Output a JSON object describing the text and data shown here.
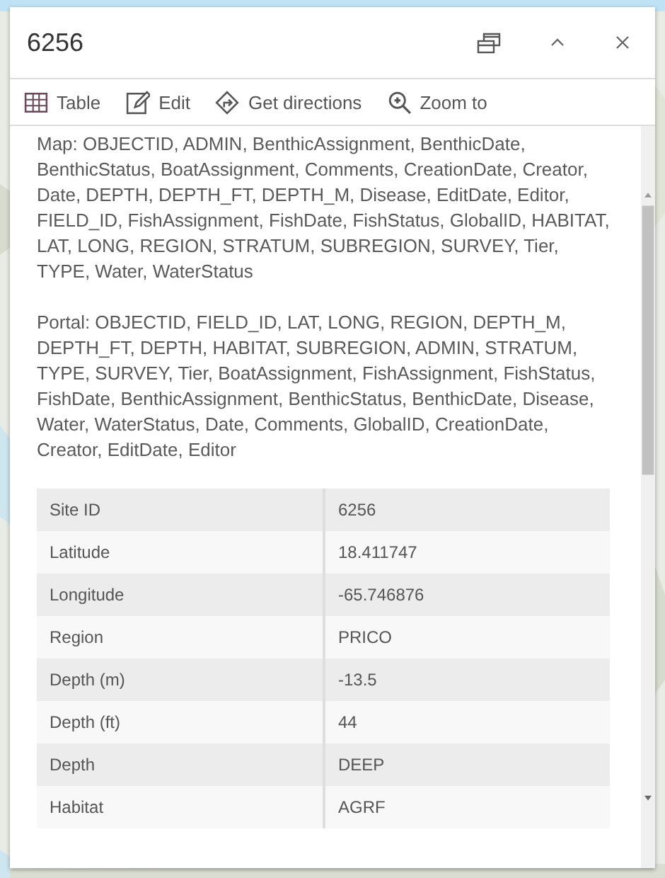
{
  "window": {
    "title": "6256"
  },
  "toolbar": [
    {
      "kind": "table",
      "label": "Table"
    },
    {
      "kind": "edit",
      "label": "Edit"
    },
    {
      "kind": "directions",
      "label": "Get directions"
    },
    {
      "kind": "zoom",
      "label": "Zoom to"
    }
  ],
  "paragraphs": [
    "Map: OBJECTID, ADMIN, BenthicAssignment, BenthicDate, BenthicStatus, BoatAssignment, Comments, CreationDate, Creator, Date, DEPTH, DEPTH_FT, DEPTH_M, Disease, EditDate, Editor, FIELD_ID, FishAssignment, FishDate, FishStatus, GlobalID, HABITAT, LAT, LONG, REGION, STRATUM, SUBREGION, SURVEY, Tier, TYPE, Water, WaterStatus",
    "Portal: OBJECTID, FIELD_ID, LAT, LONG, REGION, DEPTH_M, DEPTH_FT, DEPTH, HABITAT, SUBREGION, ADMIN, STRATUM, TYPE, SURVEY, Tier, BoatAssignment, FishAssignment, FishStatus, FishDate, BenthicAssignment, BenthicStatus, BenthicDate, Disease, Water, WaterStatus, Date, Comments, GlobalID, CreationDate, Creator, EditDate, Editor"
  ],
  "table": {
    "rows": [
      {
        "label": "Site ID",
        "value": "6256"
      },
      {
        "label": "Latitude",
        "value": "18.411747"
      },
      {
        "label": "Longitude",
        "value": "-65.746876"
      },
      {
        "label": "Region",
        "value": "PRICO"
      },
      {
        "label": "Depth (m)",
        "value": "-13.5"
      },
      {
        "label": "Depth (ft)",
        "value": "44"
      },
      {
        "label": "Depth",
        "value": "DEEP"
      },
      {
        "label": "Habitat",
        "value": "AGRF"
      }
    ]
  }
}
